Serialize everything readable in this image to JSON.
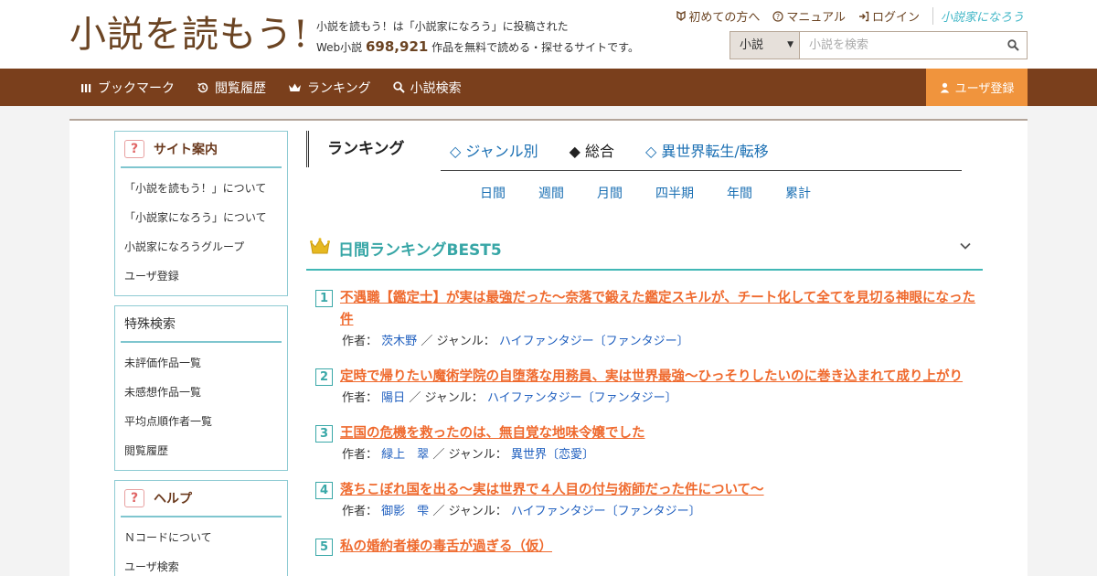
{
  "header": {
    "logo": "小説を読もう!",
    "tagline_line1": "小説を読もう！は「小説家になろう」に投稿された",
    "tagline_prefix": "Web小説",
    "work_count": "698,921",
    "tagline_suffix": "作品を無料で読める・探せるサイトです。",
    "links": [
      {
        "icon": "beginner-icon",
        "label": "初めての方へ"
      },
      {
        "icon": "help-icon",
        "label": "マニュアル"
      },
      {
        "icon": "login-icon",
        "label": "ログイン"
      }
    ],
    "brand_link": "小説家になろう",
    "search": {
      "category": "小説",
      "placeholder": "小説を検索"
    }
  },
  "nav": {
    "items": [
      {
        "icon": "bookmark-icon",
        "label": "ブックマーク"
      },
      {
        "icon": "history-icon",
        "label": "閲覧履歴"
      },
      {
        "icon": "crown-icon",
        "label": "ランキング"
      },
      {
        "icon": "search-icon",
        "label": "小説検索"
      }
    ],
    "register": "ユーザ登録"
  },
  "sidebar": {
    "site_guide": {
      "title": "サイト案内",
      "items": [
        "「小説を読もう！」について",
        "「小説家になろう」について",
        "小説家になろうグループ",
        "ユーザ登録"
      ]
    },
    "special_search": {
      "title": "特殊検索",
      "items": [
        "未評価作品一覧",
        "未感想作品一覧",
        "平均点順作者一覧",
        "閲覧履歴"
      ]
    },
    "help": {
      "title": "ヘルプ",
      "items": [
        "Ｎコードについて",
        "ユーザ検索"
      ]
    }
  },
  "ranking": {
    "heading": "ランキング",
    "tabs": [
      {
        "label": "◇ ジャンル別",
        "active": false
      },
      {
        "label": "◆ 総合",
        "active": true
      },
      {
        "label": "◇ 異世界転生/転移",
        "active": false
      }
    ],
    "periods": [
      "日間",
      "週間",
      "月間",
      "四半期",
      "年間",
      "累計"
    ],
    "best_title": "日間ランキングBEST5",
    "author_label": "作者：",
    "genre_label": "／ ジャンル：",
    "entries": [
      {
        "rank": "1",
        "title": "不遇職【鑑定士】が実は最強だった〜奈落で鍛えた鑑定スキルが、チート化して全てを見切る神眼になった件",
        "author": "茨木野",
        "genre": "ハイファンタジー〔ファンタジー〕"
      },
      {
        "rank": "2",
        "title": "定時で帰りたい魔術学院の自堕落な用務員、実は世界最強～ひっそりしたいのに巻き込まれて成り上がり",
        "author": "陽日",
        "genre": "ハイファンタジー〔ファンタジー〕"
      },
      {
        "rank": "3",
        "title": "王国の危機を救ったのは、無自覚な地味令嬢でした",
        "author": "緑上　翠",
        "genre": "異世界〔恋愛〕"
      },
      {
        "rank": "4",
        "title": "落ちこぼれ国を出る〜実は世界で４人目の付与術師だった件について〜",
        "author": "御影　雫",
        "genre": "ハイファンタジー〔ファンタジー〕"
      },
      {
        "rank": "5",
        "title": "私の婚約者様の毒舌が過ぎる（仮）",
        "author": "",
        "genre": ""
      }
    ]
  },
  "colors": {
    "brown": "#7a3f1c",
    "orange": "#f0943d",
    "teal": "#41b7b6",
    "title_orange": "#ef6a2e",
    "link_blue": "#1a6fb3"
  }
}
